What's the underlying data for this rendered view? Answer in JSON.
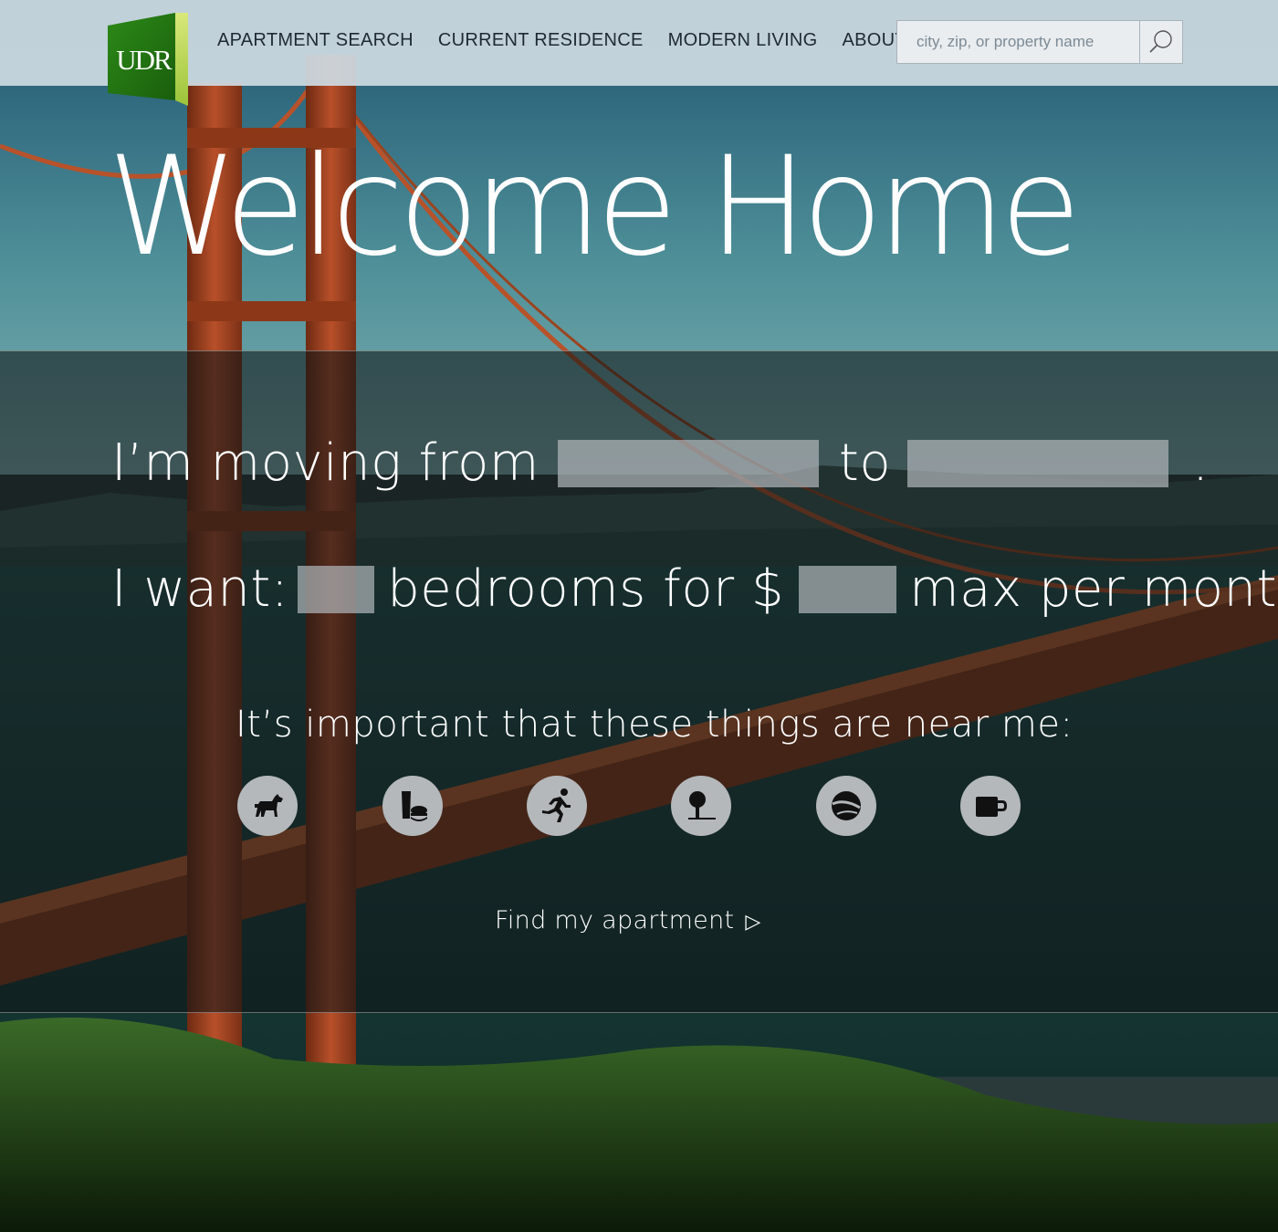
{
  "brand": {
    "logo_text": "UDR",
    "accent": "#3a9a1e"
  },
  "nav": [
    {
      "label": "APARTMENT SEARCH"
    },
    {
      "label": "CURRENT RESIDENCE"
    },
    {
      "label": "MODERN LIVING"
    },
    {
      "label": "ABOUT"
    }
  ],
  "search": {
    "placeholder": "city, zip, or property name",
    "icon": "search-icon"
  },
  "hero": {
    "title": "Welcome Home"
  },
  "form": {
    "moving_prefix": "I’m moving from",
    "to_word": "to",
    "period": ".",
    "want_prefix": "I want:",
    "bedrooms_text": "bedrooms for $",
    "max_text": "max per month.",
    "from_value": "",
    "to_value": "",
    "bedrooms_value": "",
    "price_value": ""
  },
  "amenities": {
    "label": "It’s important that these things are near me:",
    "items": [
      {
        "icon": "dog-icon"
      },
      {
        "icon": "food-drink-icon"
      },
      {
        "icon": "runner-icon"
      },
      {
        "icon": "park-tree-icon"
      },
      {
        "icon": "ball-icon"
      },
      {
        "icon": "coffee-mug-icon"
      }
    ]
  },
  "cta": {
    "label": "Find my apartment",
    "arrow": "▷"
  }
}
